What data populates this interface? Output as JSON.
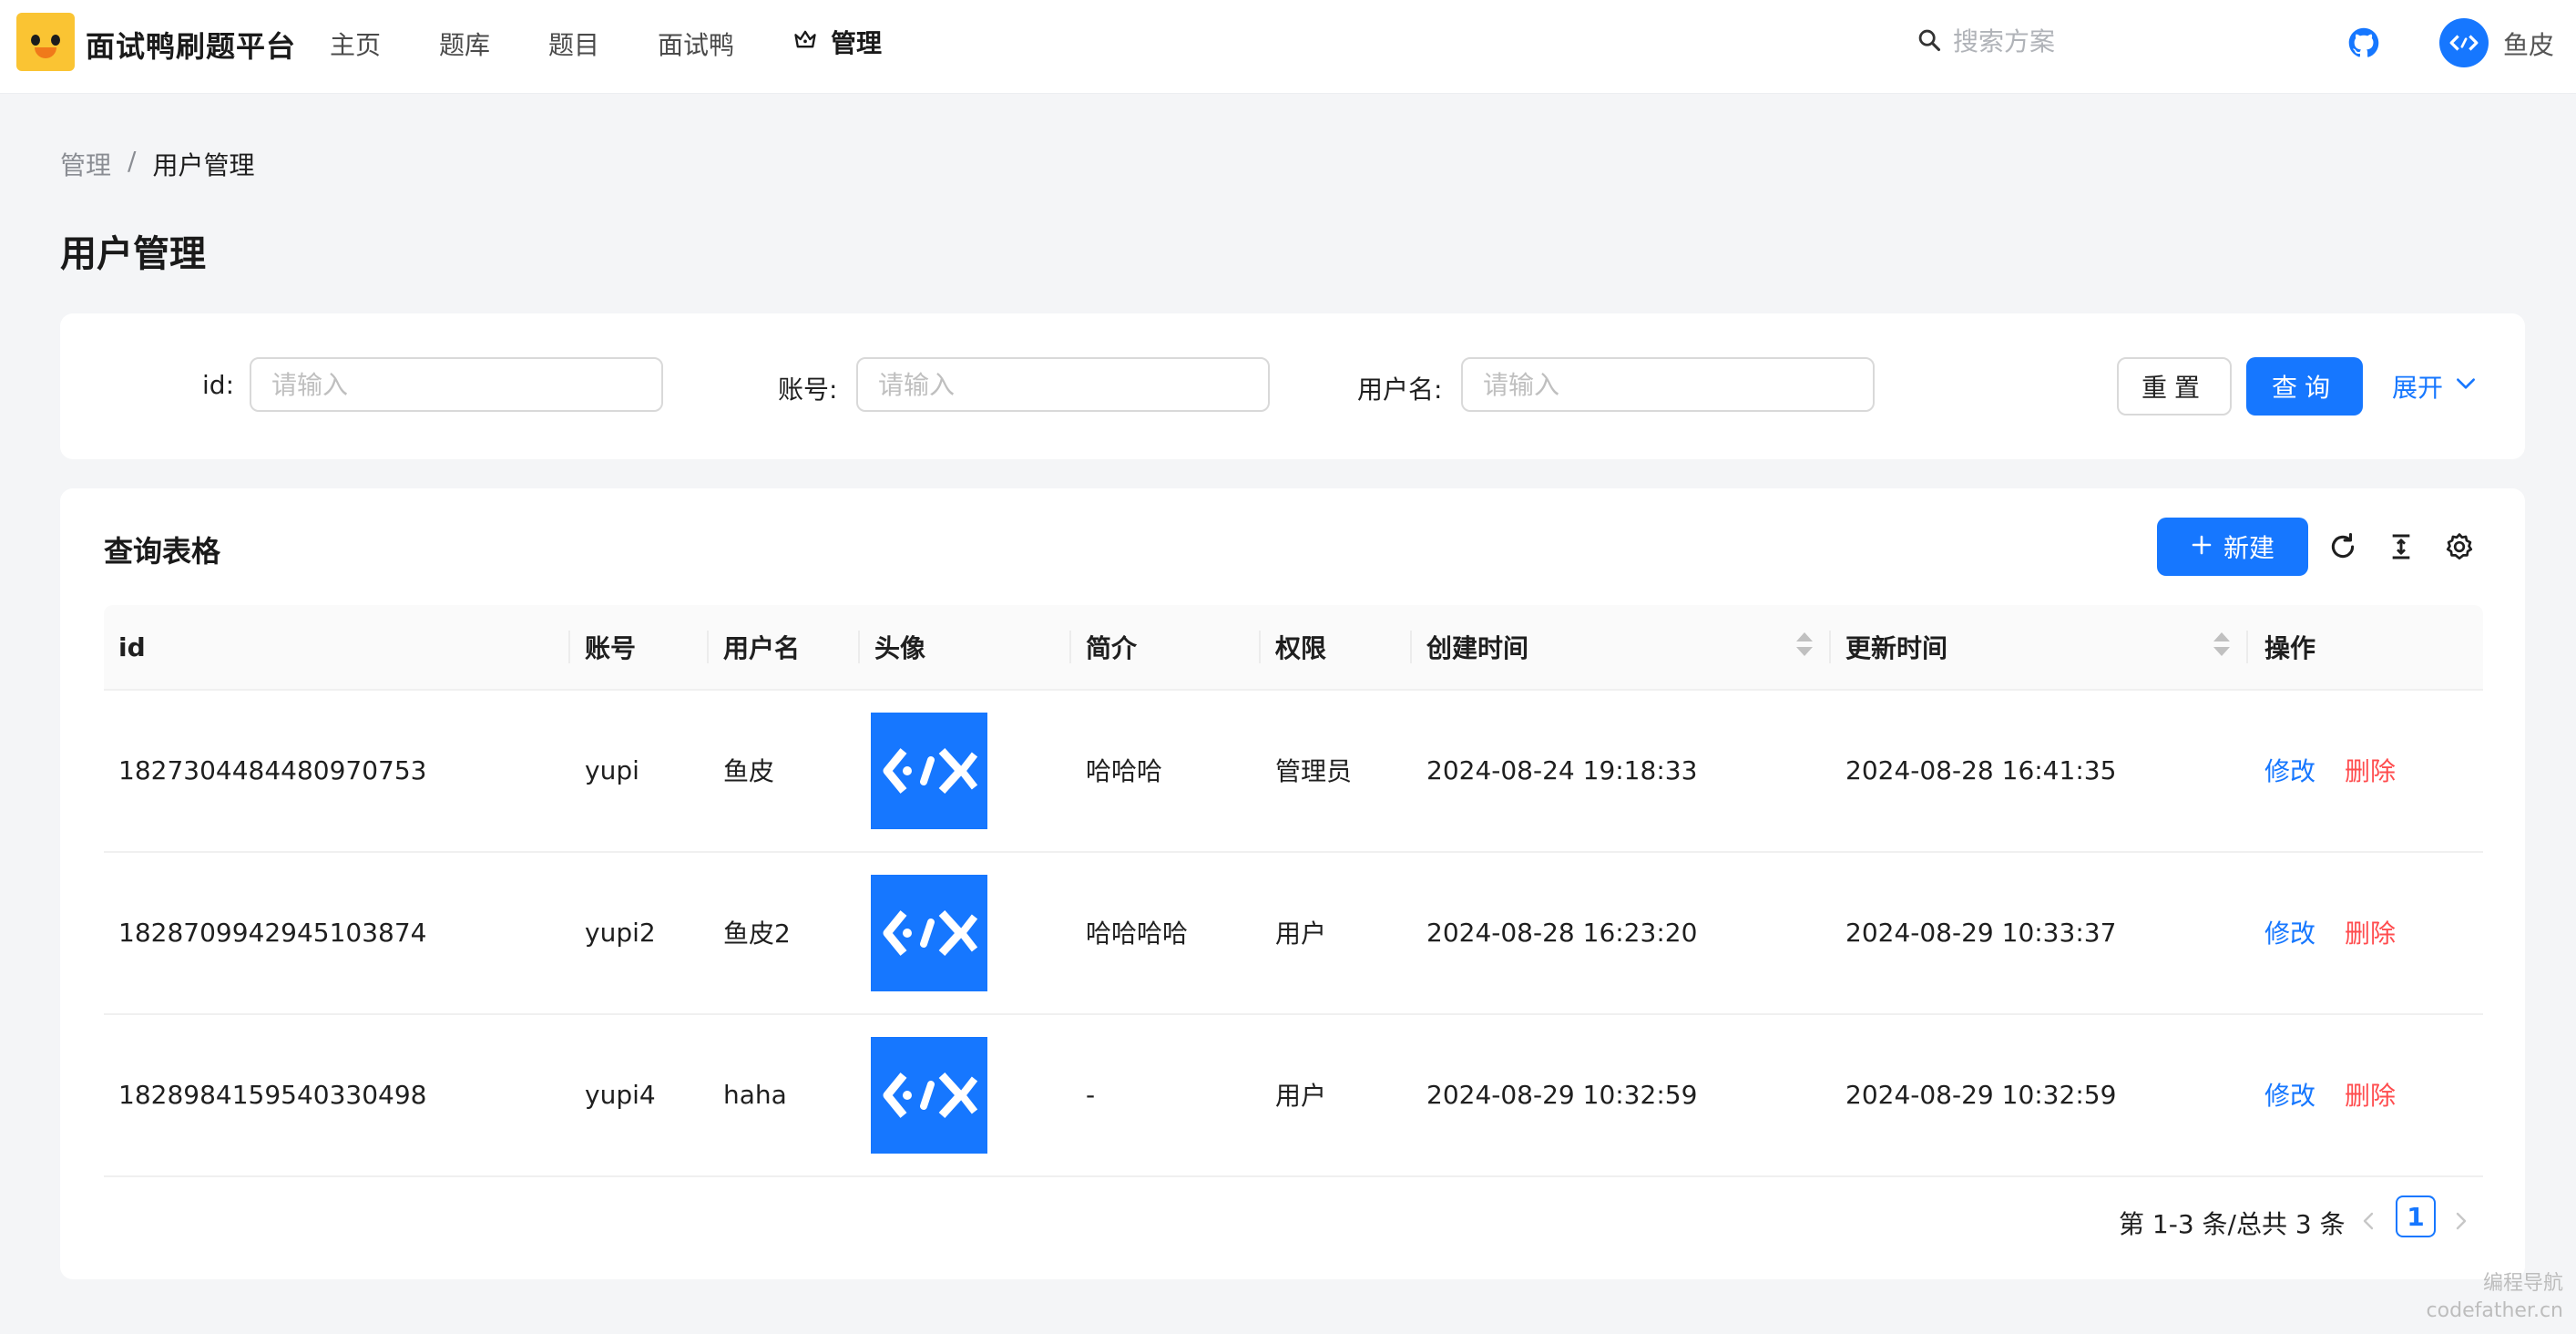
{
  "header": {
    "brand": "面试鸭刷题平台",
    "nav": [
      "主页",
      "题库",
      "题目",
      "面试鸭"
    ],
    "admin_label": "管理",
    "search_placeholder": "搜索方案",
    "user_name": "鱼皮",
    "icons": [
      "crown-icon",
      "search-icon",
      "github-icon",
      "codefather-avatar-icon"
    ]
  },
  "breadcrumb": {
    "parent": "管理",
    "separator": "/",
    "current": "用户管理"
  },
  "page_title": "用户管理",
  "search_form": {
    "fields": [
      {
        "label": "id",
        "placeholder": "请输入"
      },
      {
        "label": "账号",
        "placeholder": "请输入"
      },
      {
        "label": "用户名",
        "placeholder": "请输入"
      }
    ],
    "reset_label": "重置",
    "query_label": "查询",
    "expand_label": "展开"
  },
  "table": {
    "title": "查询表格",
    "new_label": "新建",
    "toolbar_icons": [
      "refresh-icon",
      "density-icon",
      "settings-icon"
    ],
    "columns": [
      "id",
      "账号",
      "用户名",
      "头像",
      "简介",
      "权限",
      "创建时间",
      "更新时间",
      "操作"
    ],
    "rows": [
      {
        "id": "1827304484480970753",
        "account": "yupi",
        "username": "鱼皮",
        "profile": "哈哈哈",
        "role": "管理员",
        "created": "2024-08-24 19:18:33",
        "updated": "2024-08-28 16:41:35",
        "edit": "修改",
        "delete": "删除"
      },
      {
        "id": "1828709942945103874",
        "account": "yupi2",
        "username": "鱼皮2",
        "profile": "哈哈哈哈",
        "role": "用户",
        "created": "2024-08-28 16:23:20",
        "updated": "2024-08-29 10:33:37",
        "edit": "修改",
        "delete": "删除"
      },
      {
        "id": "1828984159540330498",
        "account": "yupi4",
        "username": "haha",
        "profile": "-",
        "role": "用户",
        "created": "2024-08-29 10:32:59",
        "updated": "2024-08-29 10:32:59",
        "edit": "修改",
        "delete": "删除"
      }
    ]
  },
  "pagination": {
    "total_text": "第 1-3 条/总共 3 条",
    "current_page": "1"
  },
  "watermark": {
    "line1": "编程导航",
    "line2": "codefather.cn"
  },
  "colors": {
    "primary": "#1677ff",
    "danger": "#ff4d4f",
    "logo": "#fac433"
  }
}
